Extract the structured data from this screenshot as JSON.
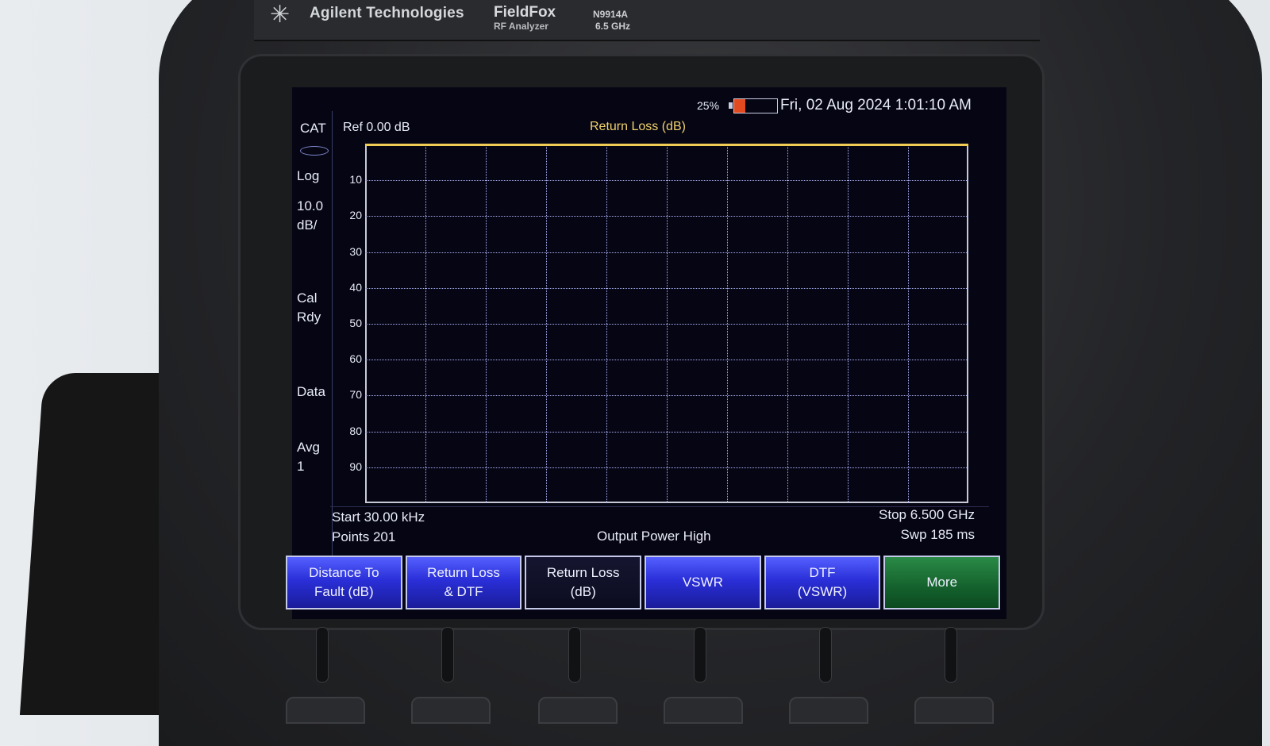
{
  "device": {
    "brand": "Agilent Technologies",
    "model_name": "FieldFox",
    "model_sub": "RF Analyzer",
    "model_number": "N9914A",
    "model_freq": "6.5 GHz"
  },
  "status": {
    "battery_pct": "25%",
    "battery_level": 0.25,
    "datetime": "Fri, 02 Aug 2024 1:01:10 AM"
  },
  "header": {
    "mode": "CAT",
    "ref": "Ref 0.00 dB",
    "trace_title": "Return Loss (dB)"
  },
  "sidebar": {
    "scale_type": "Log",
    "scale_value": "10.0",
    "scale_unit": "dB/",
    "cal_line1": "Cal",
    "cal_line2": "Rdy",
    "data": "Data",
    "avg_line1": "Avg",
    "avg_line2": "1"
  },
  "chart_data": {
    "type": "line",
    "title": "Return Loss (dB)",
    "ytick_labels": [
      "10",
      "20",
      "30",
      "40",
      "50",
      "60",
      "70",
      "80",
      "90"
    ],
    "ylim": [
      0,
      100
    ],
    "x_start": "Start 30.00 kHz",
    "x_stop": "Stop 6.500 GHz",
    "grid": true,
    "series": [
      {
        "values": [
          0,
          0
        ]
      }
    ]
  },
  "footer": {
    "start": "Start 30.00 kHz",
    "points": "Points 201",
    "output_power": "Output Power High",
    "stop": "Stop 6.500 GHz",
    "sweep": "Swp 185 ms"
  },
  "softkeys": [
    {
      "label": "Distance To\nFault (dB)"
    },
    {
      "label": "Return Loss\n& DTF"
    },
    {
      "label": "Return Loss\n(dB)"
    },
    {
      "label": "VSWR"
    },
    {
      "label": "DTF\n(VSWR)"
    },
    {
      "label": "More"
    }
  ],
  "colors": {
    "trace": "#f0cc55",
    "battery_fill": "#e24a1f",
    "softkey_blue": "#2a2fd8",
    "softkey_green": "#14612d"
  }
}
